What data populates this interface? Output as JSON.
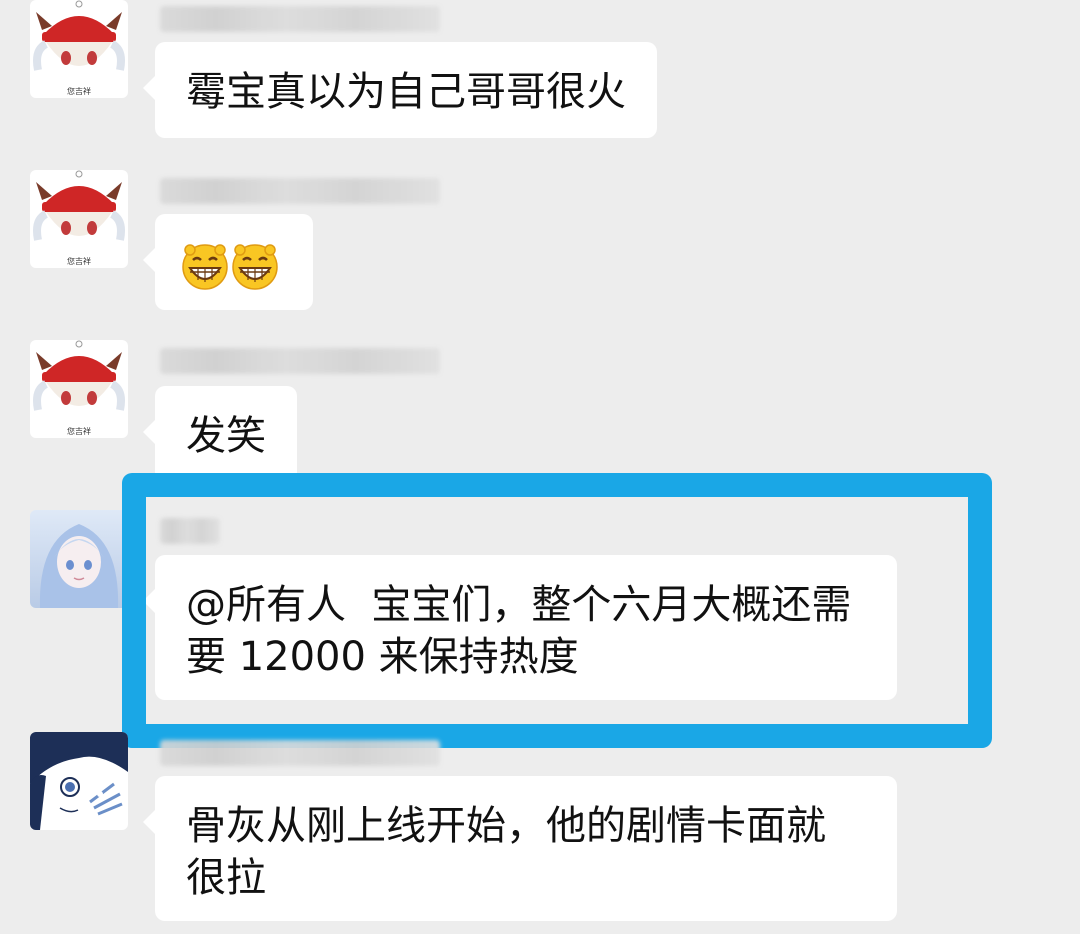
{
  "messages": [
    {
      "avatar": "red-hat-character-avatar",
      "avatar_caption": "您吉祥",
      "text": "霉宝真以为自己哥哥很火"
    },
    {
      "avatar": "red-hat-character-avatar",
      "avatar_caption": "您吉祥",
      "emoji": [
        "grin-emoji",
        "grin-emoji"
      ]
    },
    {
      "avatar": "red-hat-character-avatar",
      "avatar_caption": "您吉祥",
      "text": "发笑"
    },
    {
      "avatar": "anime-girl-avatar",
      "text_line1": "@所有人  宝宝们，整个六月大概还需",
      "text_line2": "要 12000 来保持热度"
    },
    {
      "avatar": "manga-character-avatar",
      "text_line1": "骨灰从刚上线开始，他的剧情卡面就",
      "text_line2": "很拉"
    }
  ],
  "colors": {
    "background": "#ededed",
    "bubble": "#ffffff",
    "highlight": "#1aa7e6"
  }
}
